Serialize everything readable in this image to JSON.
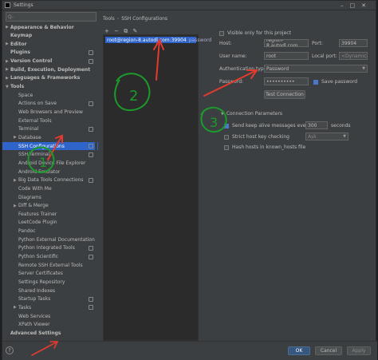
{
  "window": {
    "title": "Settings"
  },
  "search": {
    "placeholder": "Q-"
  },
  "sidebar": {
    "items": [
      {
        "label": "Appearance & Behavior",
        "level": 0,
        "arrow": "▶",
        "bold": true
      },
      {
        "label": "Keymap",
        "level": 0,
        "arrow": "",
        "bold": true
      },
      {
        "label": "Editor",
        "level": 0,
        "arrow": "▶",
        "bold": true
      },
      {
        "label": "Plugins",
        "level": 0,
        "arrow": "",
        "bold": true,
        "badge": true
      },
      {
        "label": "Version Control",
        "level": 0,
        "arrow": "▶",
        "bold": true,
        "badge": true
      },
      {
        "label": "Build, Execution, Deployment",
        "level": 0,
        "arrow": "▶",
        "bold": true
      },
      {
        "label": "Languages & Frameworks",
        "level": 0,
        "arrow": "▶",
        "bold": true
      },
      {
        "label": "Tools",
        "level": 0,
        "arrow": "▼",
        "bold": true
      },
      {
        "label": "Space",
        "level": 1,
        "arrow": ""
      },
      {
        "label": "Actions on Save",
        "level": 1,
        "arrow": "",
        "badge": true
      },
      {
        "label": "Web Browsers and Preview",
        "level": 1,
        "arrow": ""
      },
      {
        "label": "External Tools",
        "level": 1,
        "arrow": ""
      },
      {
        "label": "Terminal",
        "level": 1,
        "arrow": "",
        "badge": true
      },
      {
        "label": "Database",
        "level": 1,
        "arrow": "▶"
      },
      {
        "label": "SSH Configurations",
        "level": 1,
        "arrow": "",
        "selected": true,
        "badge": true
      },
      {
        "label": "SSH Terminal",
        "level": 1,
        "arrow": "",
        "badge": true
      },
      {
        "label": "Android Device File Explorer",
        "level": 1,
        "arrow": ""
      },
      {
        "label": "Android Emulator",
        "level": 1,
        "arrow": ""
      },
      {
        "label": "Big Data Tools Connections",
        "level": 1,
        "arrow": "▶",
        "badge": true
      },
      {
        "label": "Code With Me",
        "level": 1,
        "arrow": ""
      },
      {
        "label": "Diagrams",
        "level": 1,
        "arrow": ""
      },
      {
        "label": "Diff & Merge",
        "level": 1,
        "arrow": "▶"
      },
      {
        "label": "Features Trainer",
        "level": 1,
        "arrow": ""
      },
      {
        "label": "LeetCode Plugin",
        "level": 1,
        "arrow": ""
      },
      {
        "label": "Pandoc",
        "level": 1,
        "arrow": ""
      },
      {
        "label": "Python External Documentation",
        "level": 1,
        "arrow": ""
      },
      {
        "label": "Python Integrated Tools",
        "level": 1,
        "arrow": "",
        "badge": true
      },
      {
        "label": "Python Scientific",
        "level": 1,
        "arrow": "",
        "badge": true
      },
      {
        "label": "Remote SSH External Tools",
        "level": 1,
        "arrow": ""
      },
      {
        "label": "Server Certificates",
        "level": 1,
        "arrow": ""
      },
      {
        "label": "Settings Repository",
        "level": 1,
        "arrow": ""
      },
      {
        "label": "Shared Indexes",
        "level": 1,
        "arrow": ""
      },
      {
        "label": "Startup Tasks",
        "level": 1,
        "arrow": "",
        "badge": true
      },
      {
        "label": "Tasks",
        "level": 1,
        "arrow": "▶",
        "badge": true
      },
      {
        "label": "Web Services",
        "level": 1,
        "arrow": ""
      },
      {
        "label": "XPath Viewer",
        "level": 1,
        "arrow": ""
      },
      {
        "label": "Advanced Settings",
        "level": 0,
        "arrow": "",
        "bold": true
      }
    ]
  },
  "breadcrumb": {
    "part1": "Tools",
    "sep": "›",
    "part2": "SSH Configurations"
  },
  "toolbar": {
    "add": "+",
    "remove": "−",
    "copy": "⧉",
    "edit": "✎"
  },
  "ssh_list": {
    "item": "root@region-8.autodl.com:39904",
    "item_suffix": "password"
  },
  "form": {
    "visible_only_label": "Visible only for this project",
    "host_label": "Host:",
    "host_value": "region-8.autodl.com",
    "port_label": "Port:",
    "port_value": "39904",
    "user_label": "User name:",
    "user_value": "root",
    "local_port_label": "Local port:",
    "local_port_value": "<Dynamic>",
    "auth_label": "Authentication type:",
    "auth_value": "Password",
    "password_label": "Password:",
    "password_value": "••••••••••",
    "save_password_label": "Save password",
    "test_button": "Test Connection",
    "conn_params_label": "Connection Parameters",
    "keepalive_label": "Send keep alive messages every",
    "keepalive_value": "300",
    "seconds_label": "seconds",
    "strict_label": "Strict host key checking",
    "strict_value": "Ask",
    "hash_label": "Hash hosts in known_hosts file"
  },
  "footer": {
    "help": "?",
    "ok": "OK",
    "cancel": "Cancel",
    "apply": "Apply"
  },
  "annotations": {
    "num2": "2",
    "num3": "3",
    "num1": "1"
  },
  "colors": {
    "selection": "#2f65ca",
    "annotation_red": "#e33b2e",
    "annotation_green": "#1c9a2c"
  }
}
